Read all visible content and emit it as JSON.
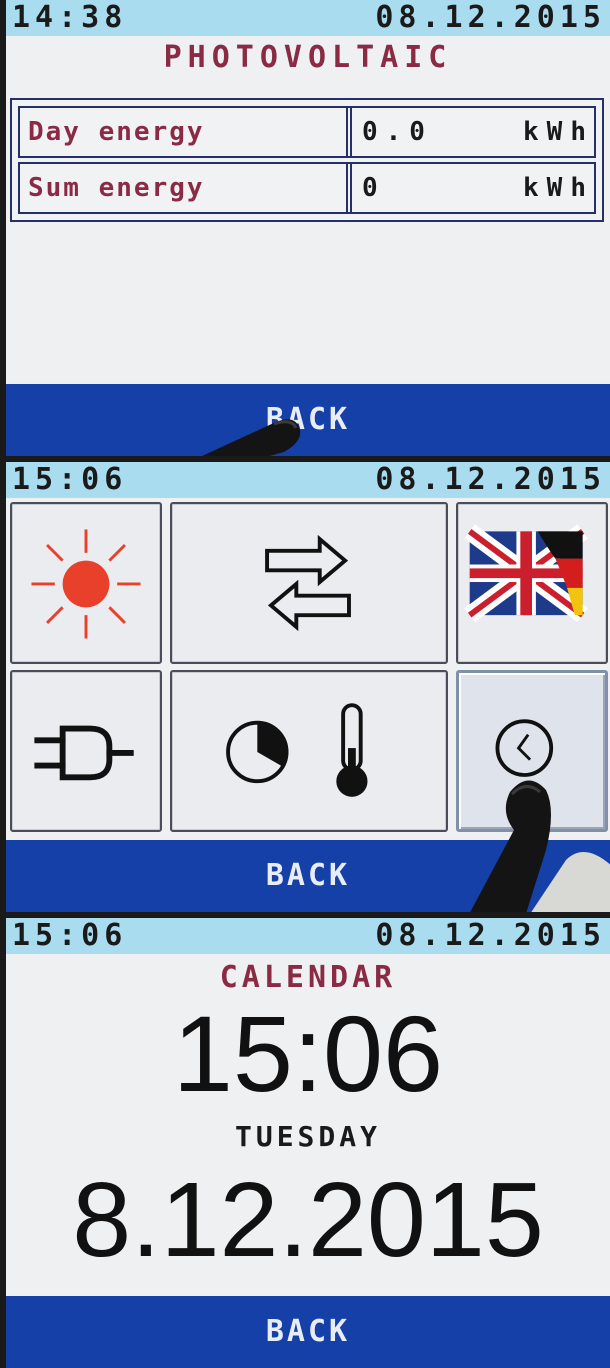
{
  "screens": [
    {
      "status": {
        "time": "14:38",
        "date": "08.12.2015"
      },
      "title": "PHOTOVOLTAIC",
      "rows": [
        {
          "label": "Day energy",
          "value": "0.0",
          "unit": "kWh"
        },
        {
          "label": "Sum energy",
          "value": "0",
          "unit": "kWh"
        }
      ],
      "back_label": "BACK"
    },
    {
      "status": {
        "time": "15:06",
        "date": "08.12.2015"
      },
      "tiles": [
        {
          "icon": "sun-icon"
        },
        {
          "icon": "transfer-arrows-icon"
        },
        {
          "icon": "language-flag-icon"
        },
        {
          "icon": "power-plug-icon"
        },
        {
          "icon": "timer-thermometer-icon"
        },
        {
          "icon": "clock-icon"
        }
      ],
      "back_label": "BACK"
    },
    {
      "status": {
        "time": "15:06",
        "date": "08.12.2015"
      },
      "title": "CALENDAR",
      "time": "15:06",
      "weekday": "TUESDAY",
      "date": "8.12.2015",
      "back_label": "BACK"
    }
  ],
  "colors": {
    "status_bar": "#a9dcef",
    "back_bar": "#1540a8",
    "title_text": "#8a2a45",
    "screen_bg": "#eef0f2",
    "sun": "#e8402a"
  }
}
